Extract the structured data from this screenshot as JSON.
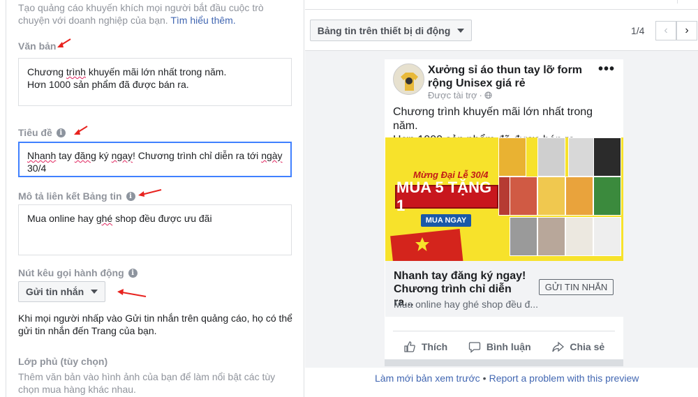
{
  "editor": {
    "intro_text": "Tạo quảng cáo khuyến khích mọi người bắt đầu cuộc trò chuyện với doanh nghiệp của bạn.",
    "learn_more": "Tìm hiểu thêm.",
    "text_label": "Văn bản",
    "text_line1_a": "Chương ",
    "text_line1_b": "trình",
    "text_line1_c": " khuyến mãi lớn nhất trong năm.",
    "text_line2": "Hơn 1000 sản phẩm đã được bán ra.",
    "headline_label": "Tiêu đề",
    "headline_w1": "Nhanh",
    "headline_w2": " tay ",
    "headline_w3": "đăng",
    "headline_w4": " ký ",
    "headline_w5": "ngay",
    "headline_w6": "! Chương trình chỉ diễn ra tới ",
    "headline_w7": "ngày",
    "headline_line2": "30/4",
    "newsfeed_desc_label": "Mô tả liên kết Bảng tin",
    "newsfeed_desc_a": "Mua online hay ",
    "newsfeed_desc_b": "ghé",
    "newsfeed_desc_c": " shop đều được ưu đãi",
    "cta_label": "Nút kêu gọi hành động",
    "cta_value": "Gửi tin nhắn",
    "cta_help": "Khi mọi người nhấp vào Gửi tin nhắn trên quảng cáo, họ có thể gửi tin nhắn đến Trang của bạn.",
    "overlay_label": "Lớp phủ (tùy chọn)",
    "overlay_help": "Thêm văn bản vào hình ảnh của bạn để làm nổi bật các tùy chọn mua hàng khác nhau."
  },
  "preview": {
    "placement": "Bảng tin trên thiết bị di động",
    "pager": "1/4",
    "page_name": "Xưởng sỉ áo thun tay lỡ form rộng Unisex giá rẻ",
    "sponsored": "Được tài trợ",
    "post_line1": "Chương trình khuyến mãi lớn nhất trong năm.",
    "post_line2": "Hơn 1000 sản phẩm đã được bán ra.",
    "banner_small": "Mừng Đại Lễ 30/4",
    "banner_main": "MUA 5 TẶNG 1",
    "banner_btn": "MUA NGAY",
    "link_title": "Nhanh tay đăng ký ngay! Chương trình chỉ diễn ra...",
    "link_desc": "Mua online hay ghé shop đều đ...",
    "cta_button": "GỬI TIN NHẮN",
    "like": "Thích",
    "comment": "Bình luận",
    "share": "Chia sẻ"
  },
  "footer": {
    "refresh": "Làm mới bản xem trước",
    "report": "Report a problem with this preview"
  },
  "colors": {
    "link_blue": "#4267b2",
    "focus_blue": "#4080ff",
    "arrow_red": "#e8231f",
    "banner_yellow": "#f7e22b"
  }
}
